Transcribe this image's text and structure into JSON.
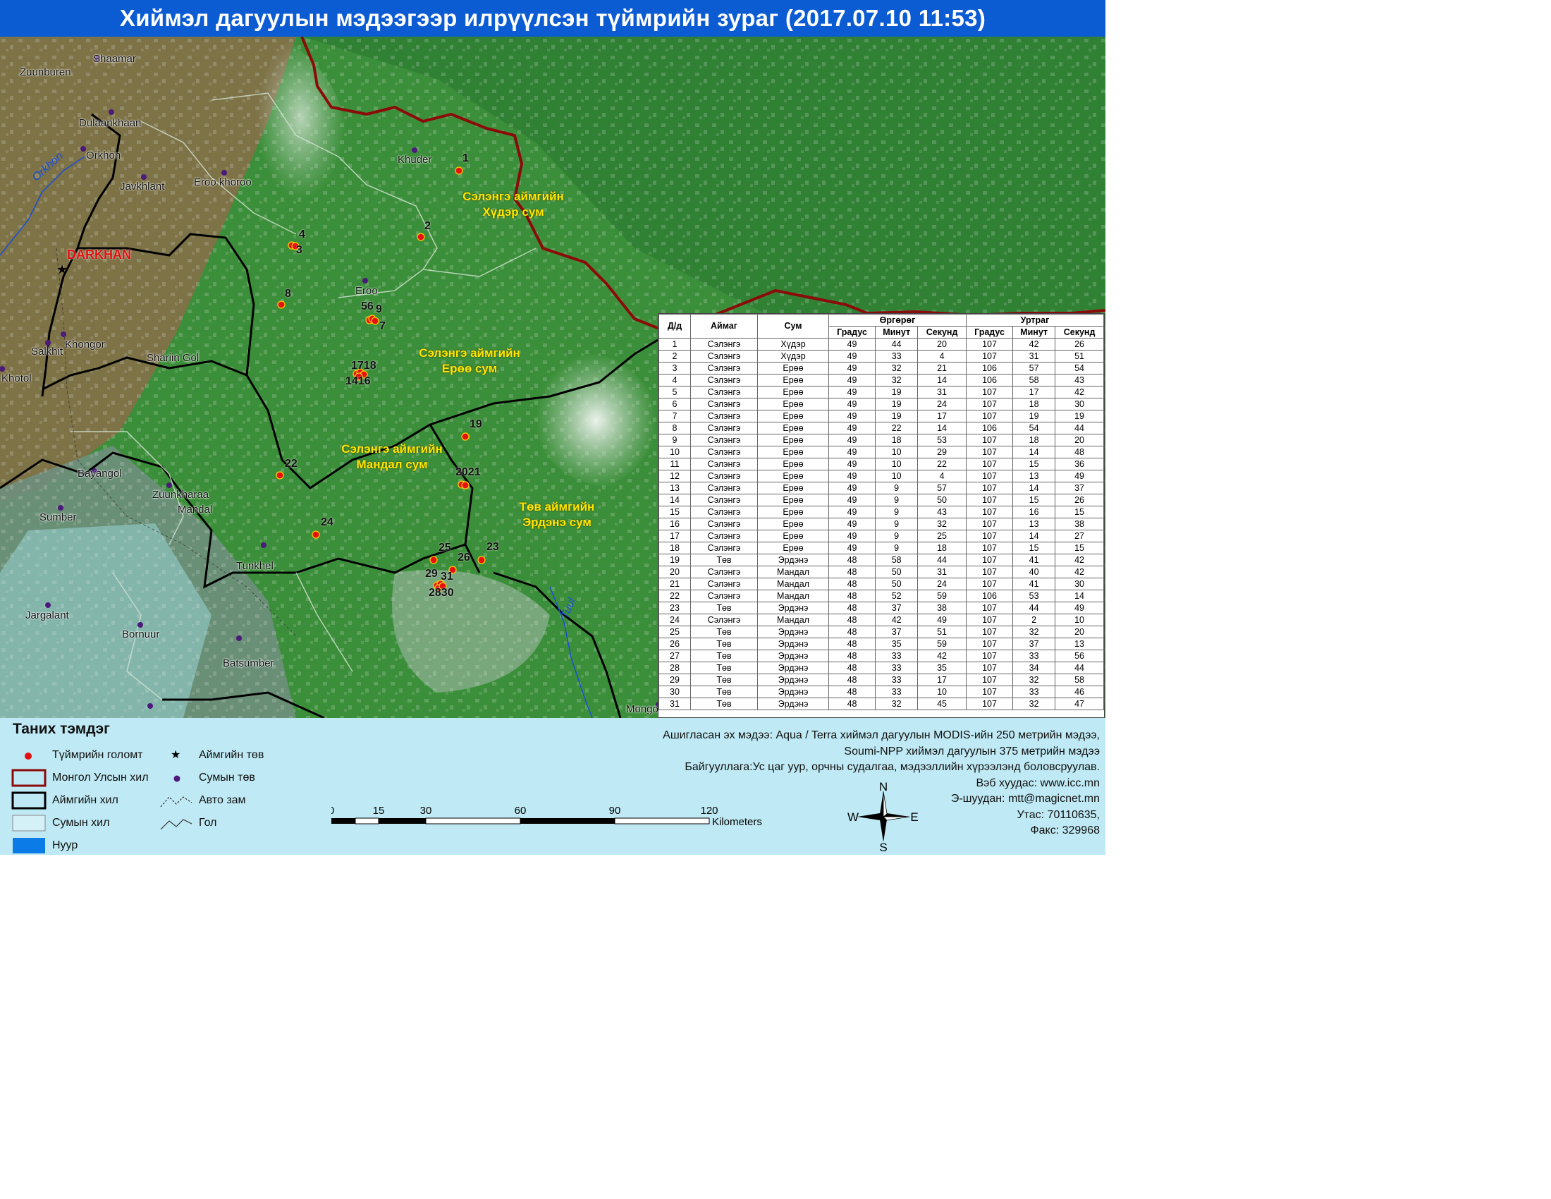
{
  "title": "Хиймэл дагуулын мэдээгээр илрүүлсэн түймрийн зураг  (2017.07.10  11:53)",
  "map": {
    "places": [
      {
        "name": "Shaamar"
      },
      {
        "name": "Zuunburen"
      },
      {
        "name": "Dulaankhaan"
      },
      {
        "name": "Orkhon"
      },
      {
        "name": "Javkhlant"
      },
      {
        "name": "Eroo khoroo"
      },
      {
        "name": "Khuder"
      },
      {
        "name": "Eroo"
      },
      {
        "name": "Khongor"
      },
      {
        "name": "Salkhit"
      },
      {
        "name": "Shariin Gol"
      },
      {
        "name": "Khotol"
      },
      {
        "name": "Bayangol"
      },
      {
        "name": "Zuunkharaa"
      },
      {
        "name": "Mandal"
      },
      {
        "name": "Sumber"
      },
      {
        "name": "Tunkhel"
      },
      {
        "name": "Jargalant"
      },
      {
        "name": "Bornuur"
      },
      {
        "name": "Batsumber"
      },
      {
        "name": "Mongo"
      }
    ],
    "aimag_center": "DARKHAN",
    "rivers": [
      "Orkhon",
      "Tuul"
    ],
    "soum_labels": [
      {
        "line1": "Сэлэнгэ аймгийн",
        "line2": "Хүдэр сум"
      },
      {
        "line1": "Сэлэнгэ аймгийн",
        "line2": "Ерөө сум"
      },
      {
        "line1": "Сэлэнгэ аймгийн",
        "line2": "Мандал сум"
      },
      {
        "line1": "Төв аймгийн",
        "line2": "Эрдэнэ сум"
      }
    ],
    "fire_labels": [
      "1",
      "2",
      "4",
      "3",
      "8",
      "56",
      "9",
      "7",
      "1718",
      "1416",
      "19",
      "22",
      "2021",
      "24",
      "25",
      "23",
      "26",
      "29",
      "31",
      "2830"
    ]
  },
  "table": {
    "headers": {
      "num": "Д/д",
      "aimag": "Аймаг",
      "sum": "Сум",
      "lat": "Өргөрөг",
      "lon": "Уртраг",
      "deg": "Градус",
      "min": "Минут",
      "sec": "Секунд"
    },
    "rows": [
      [
        "1",
        "Сэлэнгэ",
        "Хүдэр",
        "49",
        "44",
        "20",
        "107",
        "42",
        "26"
      ],
      [
        "2",
        "Сэлэнгэ",
        "Хүдэр",
        "49",
        "33",
        "4",
        "107",
        "31",
        "51"
      ],
      [
        "3",
        "Сэлэнгэ",
        "Ерөө",
        "49",
        "32",
        "21",
        "106",
        "57",
        "54"
      ],
      [
        "4",
        "Сэлэнгэ",
        "Ерөө",
        "49",
        "32",
        "14",
        "106",
        "58",
        "43"
      ],
      [
        "5",
        "Сэлэнгэ",
        "Ерөө",
        "49",
        "19",
        "31",
        "107",
        "17",
        "42"
      ],
      [
        "6",
        "Сэлэнгэ",
        "Ерөө",
        "49",
        "19",
        "24",
        "107",
        "18",
        "30"
      ],
      [
        "7",
        "Сэлэнгэ",
        "Ерөө",
        "49",
        "19",
        "17",
        "107",
        "19",
        "19"
      ],
      [
        "8",
        "Сэлэнгэ",
        "Ерөө",
        "49",
        "22",
        "14",
        "106",
        "54",
        "44"
      ],
      [
        "9",
        "Сэлэнгэ",
        "Ерөө",
        "49",
        "18",
        "53",
        "107",
        "18",
        "20"
      ],
      [
        "10",
        "Сэлэнгэ",
        "Ерөө",
        "49",
        "10",
        "29",
        "107",
        "14",
        "48"
      ],
      [
        "11",
        "Сэлэнгэ",
        "Ерөө",
        "49",
        "10",
        "22",
        "107",
        "15",
        "36"
      ],
      [
        "12",
        "Сэлэнгэ",
        "Ерөө",
        "49",
        "10",
        "4",
        "107",
        "13",
        "49"
      ],
      [
        "13",
        "Сэлэнгэ",
        "Ерөө",
        "49",
        "9",
        "57",
        "107",
        "14",
        "37"
      ],
      [
        "14",
        "Сэлэнгэ",
        "Ерөө",
        "49",
        "9",
        "50",
        "107",
        "15",
        "26"
      ],
      [
        "15",
        "Сэлэнгэ",
        "Ерөө",
        "49",
        "9",
        "43",
        "107",
        "16",
        "15"
      ],
      [
        "16",
        "Сэлэнгэ",
        "Ерөө",
        "49",
        "9",
        "32",
        "107",
        "13",
        "38"
      ],
      [
        "17",
        "Сэлэнгэ",
        "Ерөө",
        "49",
        "9",
        "25",
        "107",
        "14",
        "27"
      ],
      [
        "18",
        "Сэлэнгэ",
        "Ерөө",
        "49",
        "9",
        "18",
        "107",
        "15",
        "15"
      ],
      [
        "19",
        "Төв",
        "Эрдэнэ",
        "48",
        "58",
        "44",
        "107",
        "41",
        "42"
      ],
      [
        "20",
        "Сэлэнгэ",
        "Мандал",
        "48",
        "50",
        "31",
        "107",
        "40",
        "42"
      ],
      [
        "21",
        "Сэлэнгэ",
        "Мандал",
        "48",
        "50",
        "24",
        "107",
        "41",
        "30"
      ],
      [
        "22",
        "Сэлэнгэ",
        "Мандал",
        "48",
        "52",
        "59",
        "106",
        "53",
        "14"
      ],
      [
        "23",
        "Төв",
        "Эрдэнэ",
        "48",
        "37",
        "38",
        "107",
        "44",
        "49"
      ],
      [
        "24",
        "Сэлэнгэ",
        "Мандал",
        "48",
        "42",
        "49",
        "107",
        "2",
        "10"
      ],
      [
        "25",
        "Төв",
        "Эрдэнэ",
        "48",
        "37",
        "51",
        "107",
        "32",
        "20"
      ],
      [
        "26",
        "Төв",
        "Эрдэнэ",
        "48",
        "35",
        "59",
        "107",
        "37",
        "13"
      ],
      [
        "27",
        "Төв",
        "Эрдэнэ",
        "48",
        "33",
        "42",
        "107",
        "33",
        "56"
      ],
      [
        "28",
        "Төв",
        "Эрдэнэ",
        "48",
        "33",
        "35",
        "107",
        "34",
        "44"
      ],
      [
        "29",
        "Төв",
        "Эрдэнэ",
        "48",
        "33",
        "17",
        "107",
        "32",
        "58"
      ],
      [
        "30",
        "Төв",
        "Эрдэнэ",
        "48",
        "33",
        "10",
        "107",
        "33",
        "46"
      ],
      [
        "31",
        "Төв",
        "Эрдэнэ",
        "48",
        "32",
        "45",
        "107",
        "32",
        "47"
      ]
    ]
  },
  "legend": {
    "title": "Таних тэмдэг",
    "items": {
      "fire": "Түймрийн голомт",
      "national_border": "Монгол Улсын хил",
      "aimag_border": "Аймгийн хил",
      "soum_border": "Сумын хил",
      "lake": "Нуур",
      "aimag_center": "Аймгийн төв",
      "soum_center": "Сумын төв",
      "road": "Авто зам",
      "river": "Гол"
    },
    "colors": {
      "fire": "#e51010",
      "national_border": "#8b0a0a",
      "aimag_border": "#000000",
      "soum_center": "#4b1a7a",
      "lake": "#0b7be8"
    }
  },
  "source": {
    "line1": "Ашигласан эх мэдээ: Aqua / Terra хиймэл дагуулын MODIS-ийн 250 метрийн мэдээ,",
    "line2": "Soumi-NPP хиймэл дагуулын 375 метрийн мэдээ",
    "line3": "Байгууллага:Ус цаг уур, орчны судалгаа, мэдээллийн хүрээлэнд боловсруулав.",
    "line4": "Вэб хуудас: www.icc.mn",
    "line5": "Э-шуудан: mtt@magicnet.mn",
    "line6": "Утас: 70110635,",
    "line7": "Факс: 329968"
  },
  "scale": {
    "ticks": [
      "0",
      "15",
      "30",
      "60",
      "90",
      "120"
    ],
    "unit": "Kilometers"
  },
  "compass": {
    "n": "N",
    "s": "S",
    "e": "E",
    "w": "W"
  }
}
